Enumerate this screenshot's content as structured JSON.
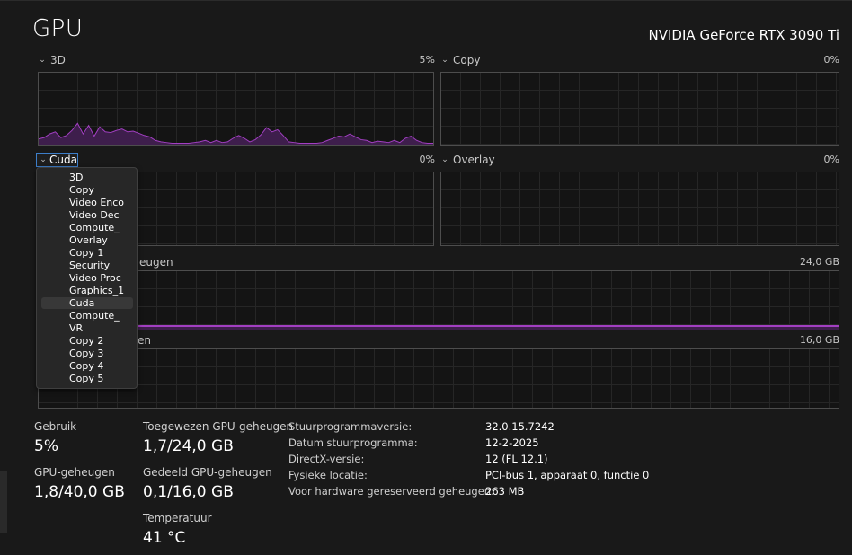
{
  "title": "GPU",
  "gpu_name": "NVIDIA GeForce RTX 3090 Ti",
  "graphs": {
    "g3d": {
      "label": "3D",
      "value": "5%"
    },
    "copy": {
      "label": "Copy",
      "value": "0%"
    },
    "cuda": {
      "label": "Cuda",
      "value": "0%"
    },
    "overlay": {
      "label": "Overlay",
      "value": "0%"
    },
    "dedicated": {
      "label_visible": "eugen",
      "value": "24,0 GB"
    },
    "shared": {
      "label_visible": "en",
      "value": "16,0 GB"
    }
  },
  "engine_options": [
    "3D",
    "Copy",
    "Video Enco",
    "Video Dec",
    "Compute_",
    "Overlay",
    "Copy 1",
    "Security",
    "Video Proc",
    "Graphics_1",
    "Cuda",
    "Compute_",
    "VR",
    "Copy 2",
    "Copy 3",
    "Copy 4",
    "Copy 5"
  ],
  "engine_selected": "Cuda",
  "stats": {
    "usage_label": "Gebruik",
    "usage_value": "5%",
    "gpu_mem_label": "GPU-geheugen",
    "gpu_mem_value": "1,8/40,0 GB",
    "dedicated_label": "Toegewezen GPU-geheugen",
    "dedicated_value": "1,7/24,0 GB",
    "shared_label": "Gedeeld GPU-geheugen",
    "shared_value": "0,1/16,0 GB",
    "temp_label": "Temperatuur",
    "temp_value": "41 °C"
  },
  "details": {
    "driver_version_label": "Stuurprogrammaversie:",
    "driver_version_value": "32.0.15.7242",
    "driver_date_label": "Datum stuurprogramma:",
    "driver_date_value": "12-2-2025",
    "directx_label": "DirectX-versie:",
    "directx_value": "12 (FL 12.1)",
    "location_label": "Fysieke locatie:",
    "location_value": "PCI-bus 1, apparaat 0, functie 0",
    "reserved_label": "Voor hardware gereserveerd geheugen:",
    "reserved_value": "263 MB"
  },
  "colors": {
    "accent": "#a23fc2",
    "fill": "#3e1e4c",
    "focus": "#3d7ec9"
  },
  "usage_history_3d": [
    8,
    10,
    15,
    18,
    10,
    13,
    20,
    30,
    15,
    27,
    12,
    25,
    18,
    17,
    20,
    22,
    18,
    19,
    16,
    13,
    11,
    6,
    4,
    3,
    2,
    2,
    2,
    2,
    3,
    4,
    6,
    3,
    6,
    3,
    4,
    9,
    13,
    9,
    4,
    7,
    14,
    24,
    18,
    21,
    13,
    4,
    3,
    2,
    2,
    2,
    2,
    3,
    6,
    9,
    12,
    11,
    15,
    11,
    7,
    6,
    3,
    5,
    4,
    3,
    6,
    3,
    9,
    12,
    6,
    3,
    2,
    2
  ]
}
